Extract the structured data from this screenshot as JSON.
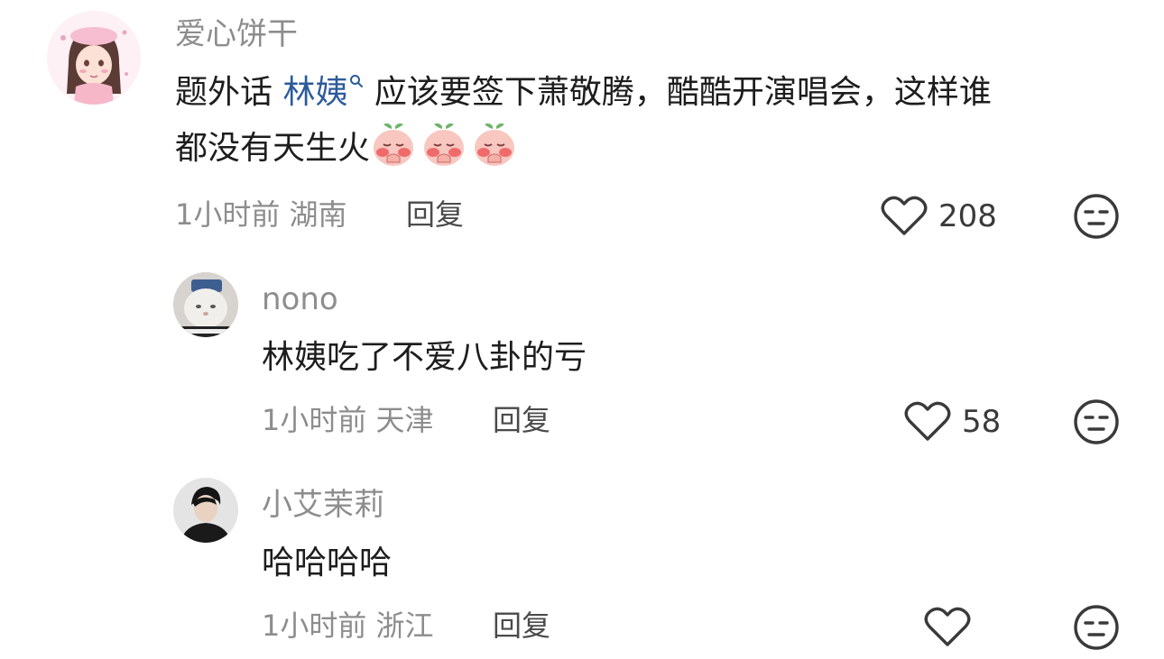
{
  "comments": [
    {
      "username": "爱心饼干",
      "text_before": "题外话 ",
      "mention": "林姨",
      "text_line1": " 应该要签下萧敬腾，酷酷开演唱会，这样谁",
      "text_line2": "都没有天生火",
      "emojis": [
        "peach-emoji",
        "peach-emoji",
        "peach-emoji"
      ],
      "time": "1小时前",
      "location": "湖南",
      "reply_label": "回复",
      "likes": "208"
    },
    {
      "username": "nono",
      "text": "林姨吃了不爱八卦的亏",
      "time": "1小时前",
      "location": "天津",
      "reply_label": "回复",
      "likes": "58"
    },
    {
      "username": "小艾茉莉",
      "text": "哈哈哈哈",
      "time": "1小时前",
      "location": "浙江",
      "reply_label": "回复",
      "likes": ""
    }
  ],
  "colors": {
    "username": "#8d8d8d",
    "mention": "#2d5b9a",
    "text": "#1d1d1d",
    "icon": "#3a3a3a"
  },
  "icons": [
    "heart-icon",
    "dislike-face-icon",
    "search-icon"
  ]
}
